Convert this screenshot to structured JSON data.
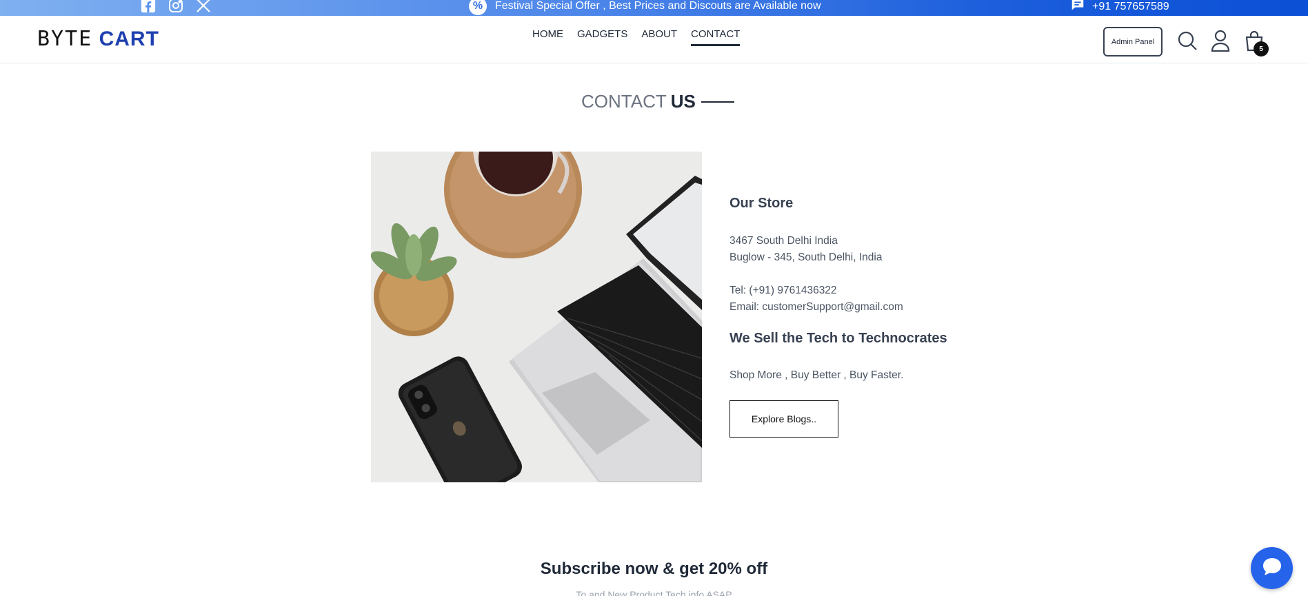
{
  "topbar": {
    "socials": [
      {
        "icon": "facebook-icon"
      },
      {
        "icon": "instagram-icon"
      },
      {
        "icon": "x-twitter-icon"
      }
    ],
    "offer_text": "Festival Special Offer , Best Prices and Discouts are Available now",
    "phone": "+91 757657589"
  },
  "header": {
    "logo_part1": "BYTE",
    "logo_part2": "CART",
    "nav": [
      {
        "label": "HOME",
        "active": false
      },
      {
        "label": "GADGETS",
        "active": false
      },
      {
        "label": "ABOUT",
        "active": false
      },
      {
        "label": "CONTACT",
        "active": true
      }
    ],
    "admin_label": "Admin Panel",
    "cart_count": "5"
  },
  "contact": {
    "title_light": "CONTACT",
    "title_bold": "US",
    "store_title": "Our Store",
    "address_line1": "3467 South Delhi India",
    "address_line2": "Buglow - 345, South Delhi, India",
    "tel": "Tel: (+91) 9761436322",
    "email": "Email: customerSupport@gmail.com",
    "tag_title": "We Sell the Tech to Technocrates",
    "tagline": "Shop More , Buy Better , Buy Faster.",
    "button_label": "Explore Blogs.."
  },
  "subscribe": {
    "title": "Subscribe now & get 20% off",
    "subtitle": "To and New Product Tech info ASAP"
  },
  "colors": {
    "brand_blue": "#1e40af",
    "chat_blue": "#2563eb"
  }
}
